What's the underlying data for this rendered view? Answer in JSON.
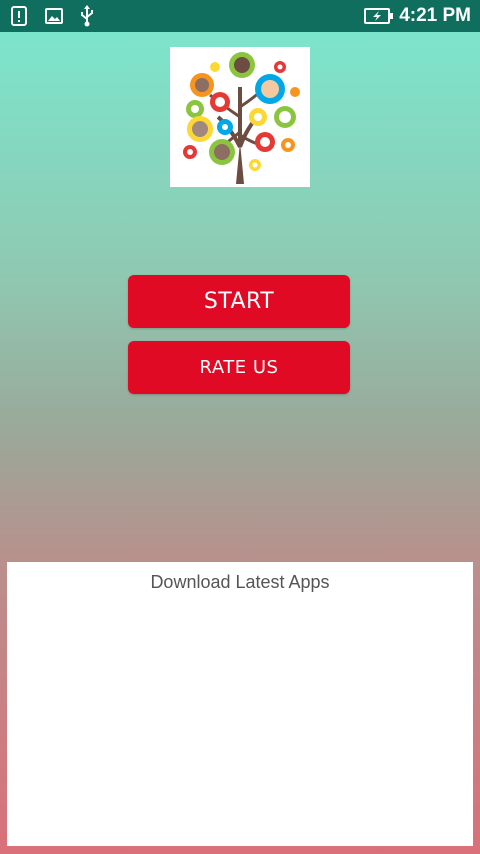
{
  "status_bar": {
    "time": "4:21 PM",
    "icons": [
      "alert-icon",
      "image-icon",
      "usb-icon",
      "battery-charging-icon"
    ]
  },
  "logo": {
    "icon": "family-tree-gears-logo",
    "colors": [
      "#8bc53f",
      "#f7941d",
      "#e53935",
      "#fdd835",
      "#00a8e8",
      "#6d4c41"
    ]
  },
  "buttons": {
    "start_label": "START",
    "rate_label": "RATE US"
  },
  "ad_panel": {
    "title": "Download Latest Apps"
  },
  "theme": {
    "button_color": "#e10a25",
    "status_bar_color": "#0f6e5d",
    "gradient_top": "#7ae8cf",
    "gradient_bottom": "#d9707a"
  }
}
